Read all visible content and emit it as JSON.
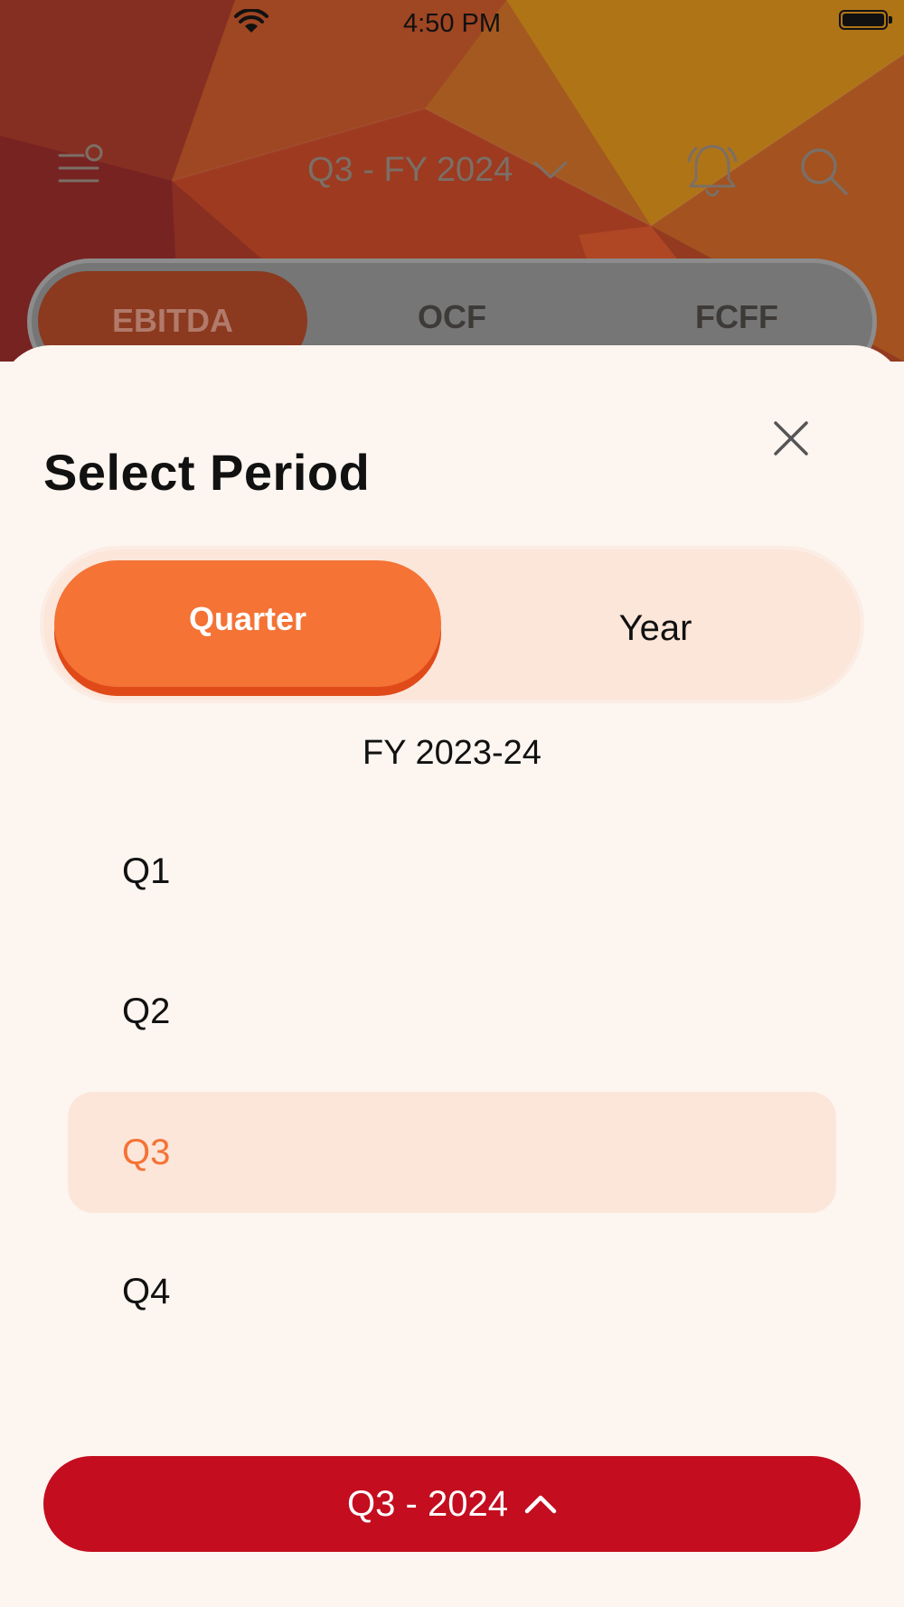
{
  "status_bar": {
    "time": "4:50 PM"
  },
  "header": {
    "period_label": "Q3 - FY 2024",
    "icons": [
      "filter-menu-icon",
      "chevron-down-icon",
      "bell-icon",
      "search-icon"
    ]
  },
  "tabs": [
    {
      "label": "EBITDA",
      "active": true
    },
    {
      "label": "OCF",
      "active": false
    },
    {
      "label": "FCFF",
      "active": false
    }
  ],
  "sheet": {
    "title": "Select Period",
    "segment": {
      "quarter_label": "Quarter",
      "year_label": "Year",
      "selected": "Quarter"
    },
    "fiscal_year": "FY 2023-24",
    "quarters": [
      {
        "label": "Q1",
        "selected": false
      },
      {
        "label": "Q2",
        "selected": false
      },
      {
        "label": "Q3",
        "selected": true
      },
      {
        "label": "Q4",
        "selected": false
      }
    ],
    "cta_label": "Q3 - 2024"
  },
  "colors": {
    "accent_orange": "#f47335",
    "cta_red": "#c40d1f",
    "sheet_background": "#fdf5f0",
    "selection_tint": "#fce6da"
  }
}
